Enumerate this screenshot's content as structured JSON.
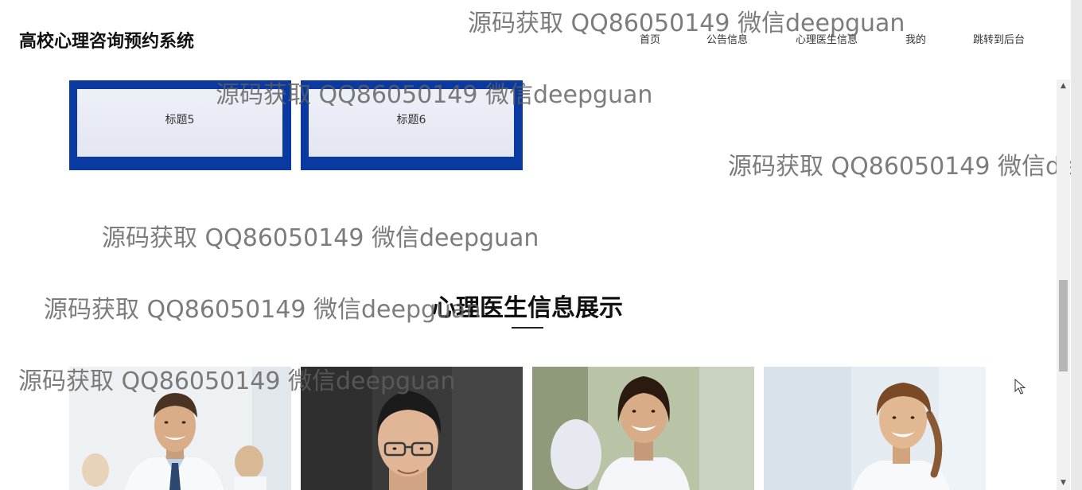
{
  "header": {
    "site_title": "高校心理咨询预约系统",
    "nav": [
      "首页",
      "公告信息",
      "心理医生信息",
      "我的",
      "跳转到后台"
    ]
  },
  "banner_cards": [
    {
      "title": "标题5"
    },
    {
      "title": "标题6"
    }
  ],
  "section": {
    "title": "心理医生信息展示"
  },
  "doctors": [
    {
      "photo": "male-doctor-smiling"
    },
    {
      "photo": "male-with-glasses"
    },
    {
      "photo": "female-doctor-smiling"
    },
    {
      "photo": "female-doctor-ponytail"
    }
  ],
  "watermark": {
    "text": "源码获取 QQ86050149 微信deepguan",
    "text_truncated": "源码获取 QQ86050149 微信dee"
  },
  "colors": {
    "card_blue": "#0a3aa1",
    "watermark": "#5f5f5f"
  }
}
